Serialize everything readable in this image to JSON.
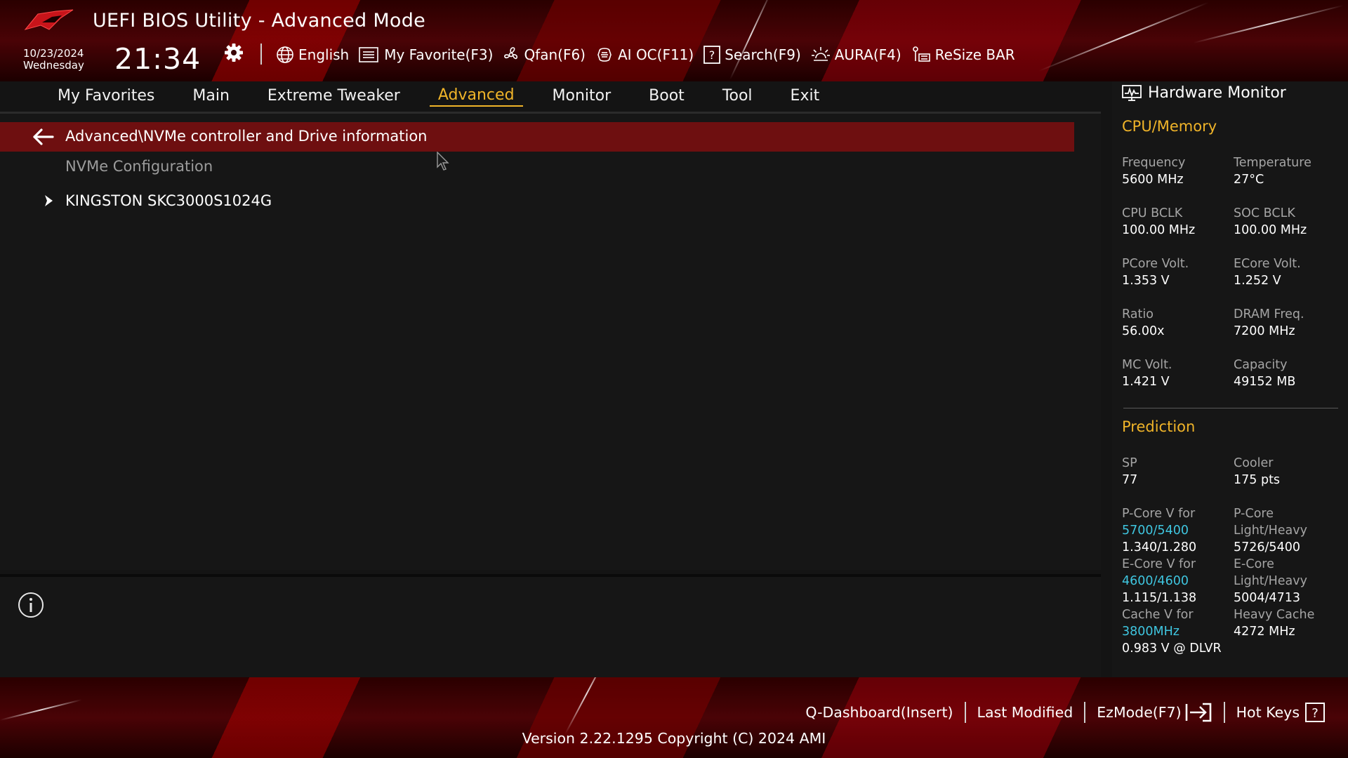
{
  "header": {
    "title": "UEFI BIOS Utility - Advanced Mode",
    "date": "10/23/2024",
    "weekday": "Wednesday",
    "time": "21:34",
    "logo_icon": "rog-eye-logo",
    "settings_icon": "gear-icon"
  },
  "toolbar": [
    {
      "icon": "globe-icon",
      "label": "English"
    },
    {
      "icon": "favorite-list-icon",
      "label": "My Favorite(F3)"
    },
    {
      "icon": "fan-icon",
      "label": "Qfan(F6)"
    },
    {
      "icon": "ai-chip-icon",
      "label": "AI OC(F11)"
    },
    {
      "icon": "search-question-icon",
      "label": "Search(F9)"
    },
    {
      "icon": "aura-light-icon",
      "label": "AURA(F4)"
    },
    {
      "icon": "resize-bar-icon",
      "label": "ReSize BAR"
    }
  ],
  "menu": {
    "items": [
      "My Favorites",
      "Main",
      "Extreme Tweaker",
      "Advanced",
      "Monitor",
      "Boot",
      "Tool",
      "Exit"
    ],
    "active": "Advanced"
  },
  "main": {
    "path": "Advanced\\NVMe controller and Drive information",
    "subheading": "NVMe Configuration",
    "drive": "KINGSTON SKC3000S1024G"
  },
  "hardware_monitor": {
    "title": "Hardware Monitor",
    "cpu_memory": {
      "heading": "CPU/Memory",
      "frequency_label": "Frequency",
      "frequency": "5600 MHz",
      "temperature_label": "Temperature",
      "temperature": "27°C",
      "cpu_bclk_label": "CPU BCLK",
      "cpu_bclk": "100.00 MHz",
      "soc_bclk_label": "SOC BCLK",
      "soc_bclk": "100.00 MHz",
      "pcore_volt_label": "PCore Volt.",
      "pcore_volt": "1.353 V",
      "ecore_volt_label": "ECore Volt.",
      "ecore_volt": "1.252 V",
      "ratio_label": "Ratio",
      "ratio": "56.00x",
      "dram_freq_label": "DRAM Freq.",
      "dram_freq": "7200 MHz",
      "mc_volt_label": "MC Volt.",
      "mc_volt": "1.421 V",
      "capacity_label": "Capacity",
      "capacity": "49152 MB"
    },
    "prediction": {
      "heading": "Prediction",
      "sp_label": "SP",
      "sp": "77",
      "cooler_label": "Cooler",
      "cooler": "175 pts",
      "pcore_v_label": "P-Core V for",
      "pcore_v_freq": "5700/5400",
      "pcore_v": "1.340/1.280",
      "pcore_lh_label_1": "P-Core",
      "pcore_lh_label_2": "Light/Heavy",
      "pcore_lh": "5726/5400",
      "ecore_v_label": "E-Core V for",
      "ecore_v_freq": "4600/4600",
      "ecore_v": "1.115/1.138",
      "ecore_lh_label_1": "E-Core",
      "ecore_lh_label_2": "Light/Heavy",
      "ecore_lh": "5004/4713",
      "cache_v_label": "Cache V for",
      "cache_v_freq": "3800MHz",
      "cache_v": "0.983 V @ DLVR",
      "heavy_cache_label": "Heavy Cache",
      "heavy_cache": "4272 MHz"
    }
  },
  "footer": {
    "links": [
      "Q-Dashboard(Insert)",
      "Last Modified",
      "EzMode(F7)",
      "Hot Keys"
    ],
    "version": "Version 2.22.1295 Copyright (C) 2024 AMI"
  },
  "colors": {
    "accent": "#f0b429",
    "path_bar": "#6e0f10",
    "highlight_value": "#3fc6e0"
  }
}
